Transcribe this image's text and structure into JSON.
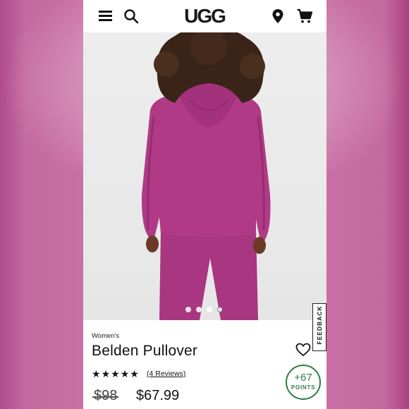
{
  "header": {
    "logo": "UGG",
    "icons": [
      "menu-icon",
      "search-icon",
      "location-pin-icon",
      "cart-icon"
    ]
  },
  "carousel": {
    "dot_count": 4,
    "active_index": 3
  },
  "feedback_label": "FEEDBACK",
  "product": {
    "category": "Women's",
    "title": "Belden Pullover",
    "rating_stars": 5,
    "reviews_label": "(4 Reviews)",
    "original_price": "$98",
    "sale_price": "$67.99"
  },
  "points": {
    "value": "+67",
    "label": "POINTS"
  },
  "colors": {
    "hoodie": "#b03a86",
    "background": "#c86fa5",
    "points_green": "#2c7d46"
  }
}
